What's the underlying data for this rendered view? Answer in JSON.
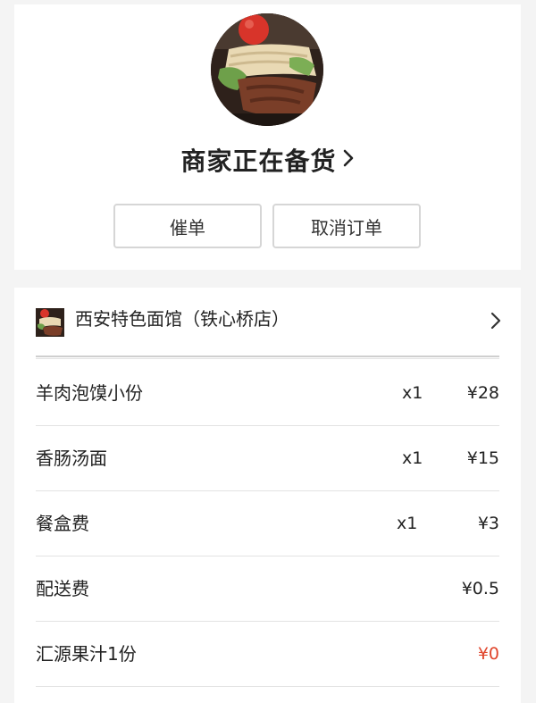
{
  "status": {
    "title": "商家正在备货",
    "urge_label": "催单",
    "cancel_label": "取消订单"
  },
  "shop": {
    "name": "西安特色面馆（铁心桥店）"
  },
  "items": [
    {
      "name": "羊肉泡馍小份",
      "qty": "x1",
      "price": "¥28"
    },
    {
      "name": "香肠汤面",
      "qty": "x1",
      "price": "¥15"
    },
    {
      "name": "餐盒费",
      "qty": "x1",
      "price": "¥3"
    },
    {
      "name": "配送费",
      "qty": "",
      "price": "¥0.5"
    },
    {
      "name": "汇源果汁1份",
      "qty": "",
      "price": "¥0"
    }
  ],
  "colors": {
    "accent_red": "#e0452b",
    "background": "#f4f4f4",
    "card": "#ffffff"
  },
  "icons": {
    "status_chevron": "chevron-right-icon",
    "shop_chevron": "chevron-right-icon"
  }
}
